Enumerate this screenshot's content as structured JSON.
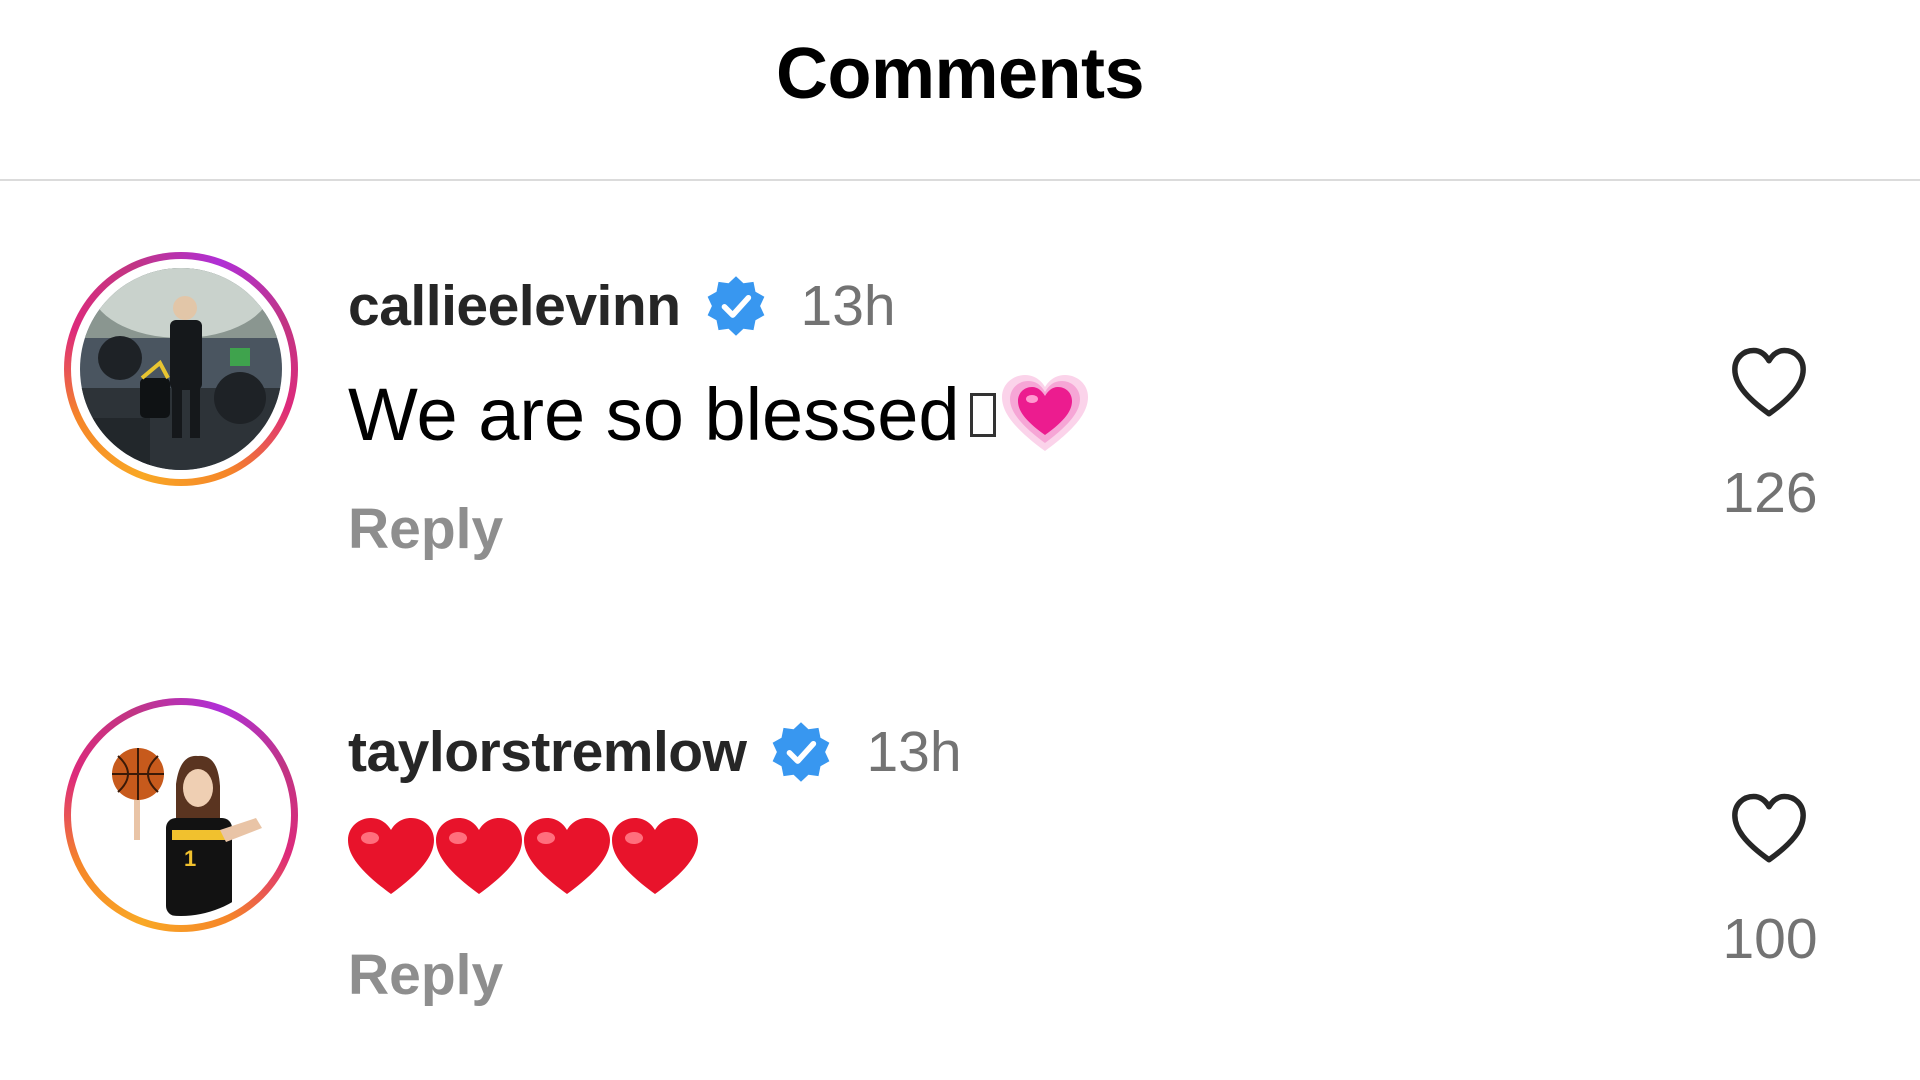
{
  "header": {
    "title": "Comments"
  },
  "comments": [
    {
      "username": "callieelevinn",
      "verified": true,
      "timestamp": "13h",
      "text": "We are so blessed",
      "emoji": [
        "missing-glyph",
        "growing-heart-emoji"
      ],
      "reply_label": "Reply",
      "like_count": "126",
      "avatar_ring_colors": [
        "#f9a825",
        "#dd2a7b",
        "#b02fd6"
      ]
    },
    {
      "username": "taylorstremlow",
      "verified": true,
      "timestamp": "13h",
      "text": "",
      "emoji": [
        "red-heart-emoji",
        "red-heart-emoji",
        "red-heart-emoji",
        "red-heart-emoji"
      ],
      "reply_label": "Reply",
      "like_count": "100",
      "avatar_ring_colors": [
        "#f9a825",
        "#dd2a7b",
        "#b02fd6"
      ]
    }
  ],
  "colors": {
    "verified_badge": "#3897f0",
    "secondary_text": "#737373",
    "reply_text": "#8e8e8e",
    "divider": "#dbdbdb"
  }
}
